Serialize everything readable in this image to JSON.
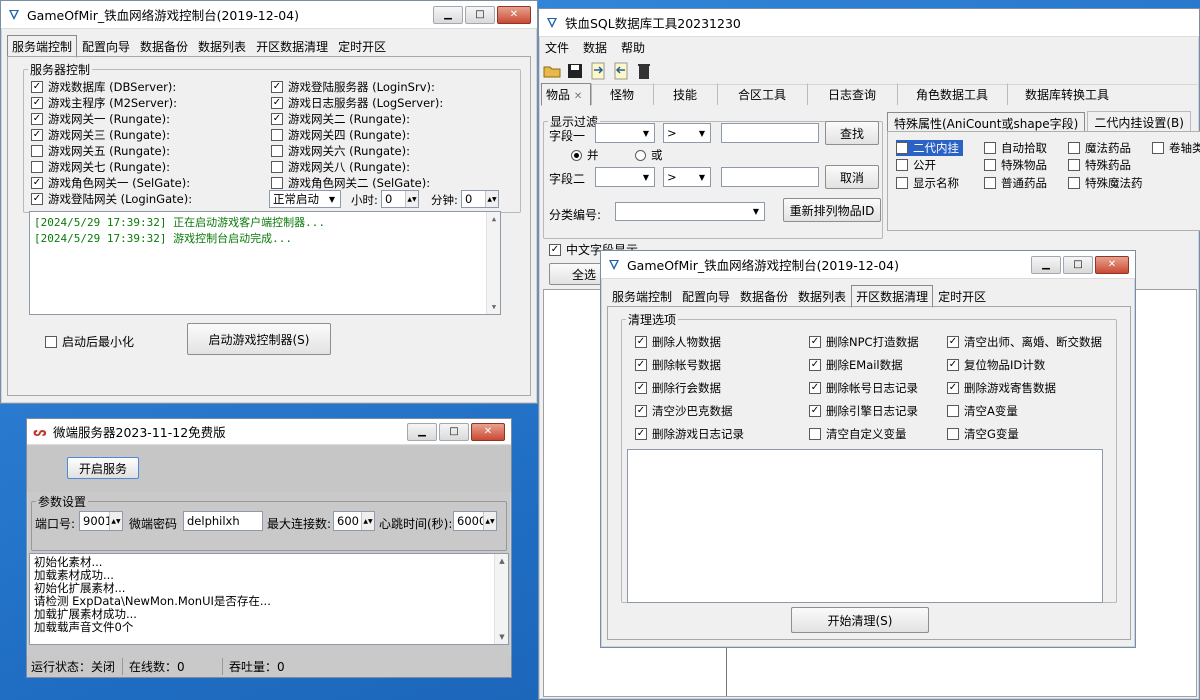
{
  "win1": {
    "title": "GameOfMir_铁血网络游戏控制台(2019-12-04)",
    "tabs": [
      "服务端控制",
      "配置向导",
      "数据备份",
      "数据列表",
      "开区数据清理",
      "定时开区"
    ],
    "group_label": "服务器控制",
    "checks_left": [
      {
        "label": "游戏数据库 (DBServer):",
        "on": true
      },
      {
        "label": "游戏主程序 (M2Server):",
        "on": true
      },
      {
        "label": "游戏网关一 (Rungate):",
        "on": true
      },
      {
        "label": "游戏网关三 (Rungate):",
        "on": true
      },
      {
        "label": "游戏网关五 (Rungate):",
        "on": false
      },
      {
        "label": "游戏网关七 (Rungate):",
        "on": false
      },
      {
        "label": "游戏角色网关一 (SelGate):",
        "on": true
      },
      {
        "label": "游戏登陆网关 (LoginGate):",
        "on": true
      }
    ],
    "checks_right": [
      {
        "label": "游戏登陆服务器 (LoginSrv):",
        "on": true
      },
      {
        "label": "游戏日志服务器 (LogServer):",
        "on": true
      },
      {
        "label": "游戏网关二 (Rungate):",
        "on": true
      },
      {
        "label": "游戏网关四 (Rungate):",
        "on": false
      },
      {
        "label": "游戏网关六 (Rungate):",
        "on": false
      },
      {
        "label": "游戏网关八 (Rungate):",
        "on": false
      },
      {
        "label": "游戏角色网关二 (SelGate):",
        "on": false
      }
    ],
    "start_mode": "正常启动",
    "hour_label": "小时:",
    "hour_value": "0",
    "minute_label": "分钟:",
    "minute_value": "0",
    "log_lines": [
      "[2024/5/29 17:39:32] 正在启动游戏客户端控制器...",
      "[2024/5/29 17:39:32] 游戏控制台启动完成..."
    ],
    "minimize_label": "启动后最小化",
    "start_button": "启动游戏控制器(S)"
  },
  "win2": {
    "title": "微端服务器2023-11-12免费版",
    "start_button": "开启服务",
    "group_label": "参数设置",
    "port_label": "端口号:",
    "port_value": "9001",
    "password_label": "微端密码",
    "password_value": "delphilxh",
    "maxconn_label": "最大连接数:",
    "maxconn_value": "600",
    "heartbeat_label": "心跳时间(秒):",
    "heartbeat_value": "6000",
    "log_lines": [
      "初始化素材...",
      "加载素材成功...",
      "初始化扩展素材...",
      "请检测 ExpData\\NewMon.MonUI是否存在...",
      "加载扩展素材成功...",
      "加载载声音文件0个"
    ],
    "status_run": "运行状态：关闭",
    "status_online": "在线数：0",
    "status_throughput": "吞吐量：0"
  },
  "win3": {
    "title": "铁血SQL数据库工具20231230",
    "menu": [
      "文件",
      "数据",
      "帮助"
    ],
    "tabs": [
      "物品",
      "怪物",
      "技能",
      "合区工具",
      "日志查询",
      "角色数据工具",
      "数据库转换工具"
    ],
    "filter_group": "显示过滤",
    "field1_label": "字段一",
    "field2_label": "字段二",
    "op1": ">",
    "op2": ">",
    "and_label": "并",
    "or_label": "或",
    "search_button": "查找",
    "cancel_button": "取消",
    "category_label": "分类编号:",
    "reorder_button": "重新排列物品ID",
    "special_tab": "特殊属性(AniCount或shape字段)",
    "hang_tab": "二代内挂设置(B)",
    "attr_items": [
      {
        "label": "二代内挂",
        "on": false,
        "highlight": true
      },
      {
        "label": "自动拾取",
        "on": false
      },
      {
        "label": "魔法药品",
        "on": false
      },
      {
        "label": "卷轴类",
        "on": false
      },
      {
        "label": "公开",
        "on": false
      },
      {
        "label": "特殊物品",
        "on": false
      },
      {
        "label": "特殊药品",
        "on": false
      },
      {
        "label": "显示名称",
        "on": false
      },
      {
        "label": "普通药品",
        "on": false
      },
      {
        "label": "特殊魔法药",
        "on": false
      }
    ],
    "cn_field_label": "中文字段显示",
    "select_all": "全选"
  },
  "win4": {
    "title": "GameOfMir_铁血网络游戏控制台(2019-12-04)",
    "tabs": [
      "服务端控制",
      "配置向导",
      "数据备份",
      "数据列表",
      "开区数据清理",
      "定时开区"
    ],
    "group_label": "清理选项",
    "col1": [
      {
        "label": "删除人物数据",
        "on": true
      },
      {
        "label": "删除帐号数据",
        "on": true
      },
      {
        "label": "删除行会数据",
        "on": true
      },
      {
        "label": "清空沙巴克数据",
        "on": true
      },
      {
        "label": "删除游戏日志记录",
        "on": true
      }
    ],
    "col2": [
      {
        "label": "删除NPC打造数据",
        "on": true
      },
      {
        "label": "删除EMail数据",
        "on": true
      },
      {
        "label": "删除帐号日志记录",
        "on": true
      },
      {
        "label": "删除引擎日志记录",
        "on": true
      },
      {
        "label": "清空自定义变量",
        "on": false
      }
    ],
    "col3": [
      {
        "label": "清空出师、离婚、断交数据",
        "on": true
      },
      {
        "label": "复位物品ID计数",
        "on": true
      },
      {
        "label": "删除游戏寄售数据",
        "on": true
      },
      {
        "label": "清空A变量",
        "on": false
      },
      {
        "label": "清空G变量",
        "on": false
      }
    ],
    "start_button": "开始清理(S)"
  }
}
